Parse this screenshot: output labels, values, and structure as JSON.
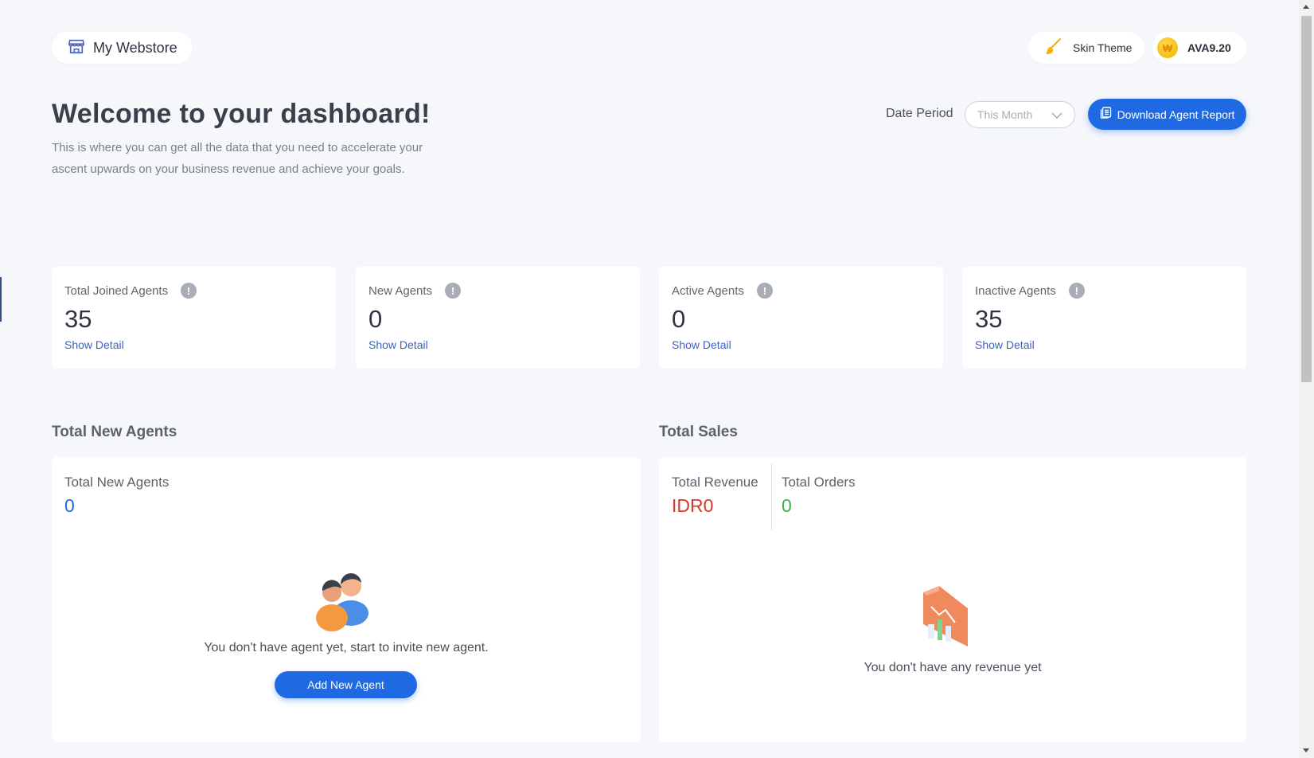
{
  "header": {
    "store_label": "My Webstore",
    "skin_theme_label": "Skin Theme",
    "balance_label": "AVA9.20"
  },
  "welcome": {
    "title": "Welcome to your dashboard!",
    "subtitle": "This is where you can get all the data that you need to accelerate your ascent upwards on your business revenue and achieve your goals."
  },
  "filters": {
    "date_period_label": "Date Period",
    "date_period_value": "This Month",
    "download_button": "Download Agent Report"
  },
  "stats": [
    {
      "label": "Total Joined Agents",
      "value": "35",
      "link": "Show Detail"
    },
    {
      "label": "New Agents",
      "value": "0",
      "link": "Show Detail"
    },
    {
      "label": "Active Agents",
      "value": "0",
      "link": "Show Detail"
    },
    {
      "label": "Inactive Agents",
      "value": "35",
      "link": "Show Detail"
    }
  ],
  "total_new_agents": {
    "section_title": "Total New Agents",
    "label": "Total New Agents",
    "value": "0",
    "empty_message": "You don't have agent yet, start to invite new agent.",
    "add_button": "Add New Agent"
  },
  "total_sales": {
    "section_title": "Total Sales",
    "revenue_label": "Total Revenue",
    "revenue_value": "IDR0",
    "orders_label": "Total Orders",
    "orders_value": "0",
    "empty_message": "You don't have any revenue yet"
  },
  "colors": {
    "primary": "#1f6ae3",
    "link": "#3a63c2",
    "revenue": "#d7382c",
    "orders": "#35b34a",
    "background": "#f5f7fa"
  }
}
